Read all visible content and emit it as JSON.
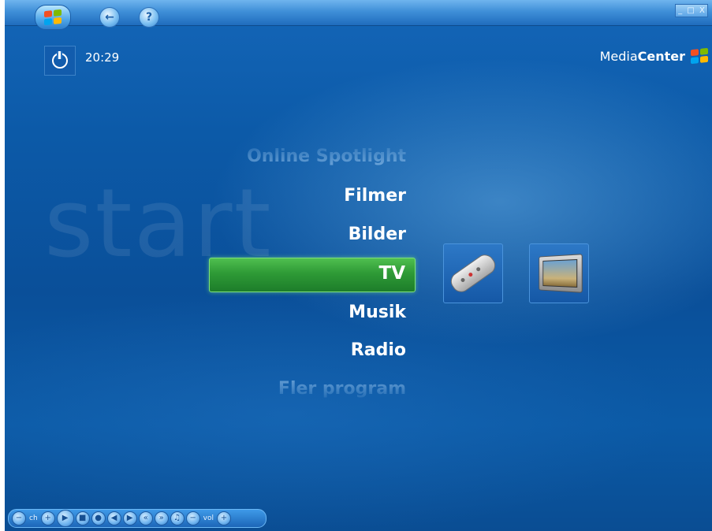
{
  "titlebar": {
    "back_icon": "back-arrow-icon",
    "help_label": "?",
    "window_controls": [
      "_",
      "□",
      "X"
    ]
  },
  "status": {
    "time": "20:29",
    "power_icon": "power-icon"
  },
  "brand": {
    "media": "Media",
    "center": "Center"
  },
  "watermark": "start",
  "menu": {
    "items": [
      {
        "label": "Online Spotlight",
        "state": "faded"
      },
      {
        "label": "Filmer",
        "state": "normal"
      },
      {
        "label": "Bilder",
        "state": "normal"
      },
      {
        "label": "TV",
        "state": "selected"
      },
      {
        "label": "Musik",
        "state": "normal"
      },
      {
        "label": "Radio",
        "state": "normal"
      },
      {
        "label": "Fler program",
        "state": "faded"
      }
    ],
    "selected_color": "#2e9a36"
  },
  "tiles": [
    {
      "icon": "remote-control-icon"
    },
    {
      "icon": "tv-screen-icon"
    }
  ],
  "transport": {
    "ch_label": "ch",
    "vol_label": "vol",
    "minus": "−",
    "plus": "+",
    "buttons": [
      "play-icon",
      "stop-icon",
      "record-icon",
      "rewind-icon",
      "forward-icon",
      "mute-icon"
    ]
  },
  "colors": {
    "background": "#0c5aa8",
    "accent_green": "#2e9a36"
  }
}
